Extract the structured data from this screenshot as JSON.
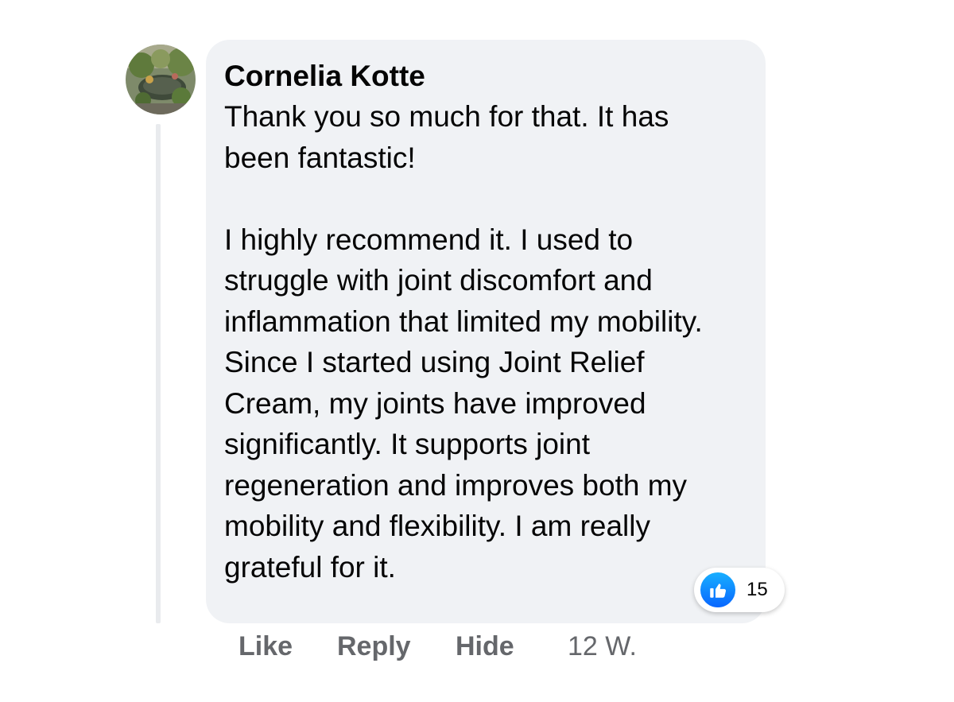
{
  "comment": {
    "author": "Cornelia Kotte",
    "paragraphs": [
      [
        "Thank you so much for that. It has",
        "been fantastic!"
      ],
      [
        "I highly recommend it. I used to",
        "struggle with joint discomfort and",
        "inflammation that limited my mobility.",
        "Since I started using Joint Relief",
        "Cream, my joints have improved",
        "significantly. It supports joint",
        "regeneration and improves both my",
        "mobility and flexibility. I am really",
        "grateful for it."
      ]
    ],
    "reactions": {
      "icon": "like-icon",
      "count": "15"
    }
  },
  "actions": {
    "like": "Like",
    "reply": "Reply",
    "hide": "Hide",
    "time": "12 W."
  },
  "colors": {
    "bubble": "#f0f2f5",
    "text": "#050505",
    "action_text": "#65676b",
    "like_blue": "#0866ff"
  }
}
